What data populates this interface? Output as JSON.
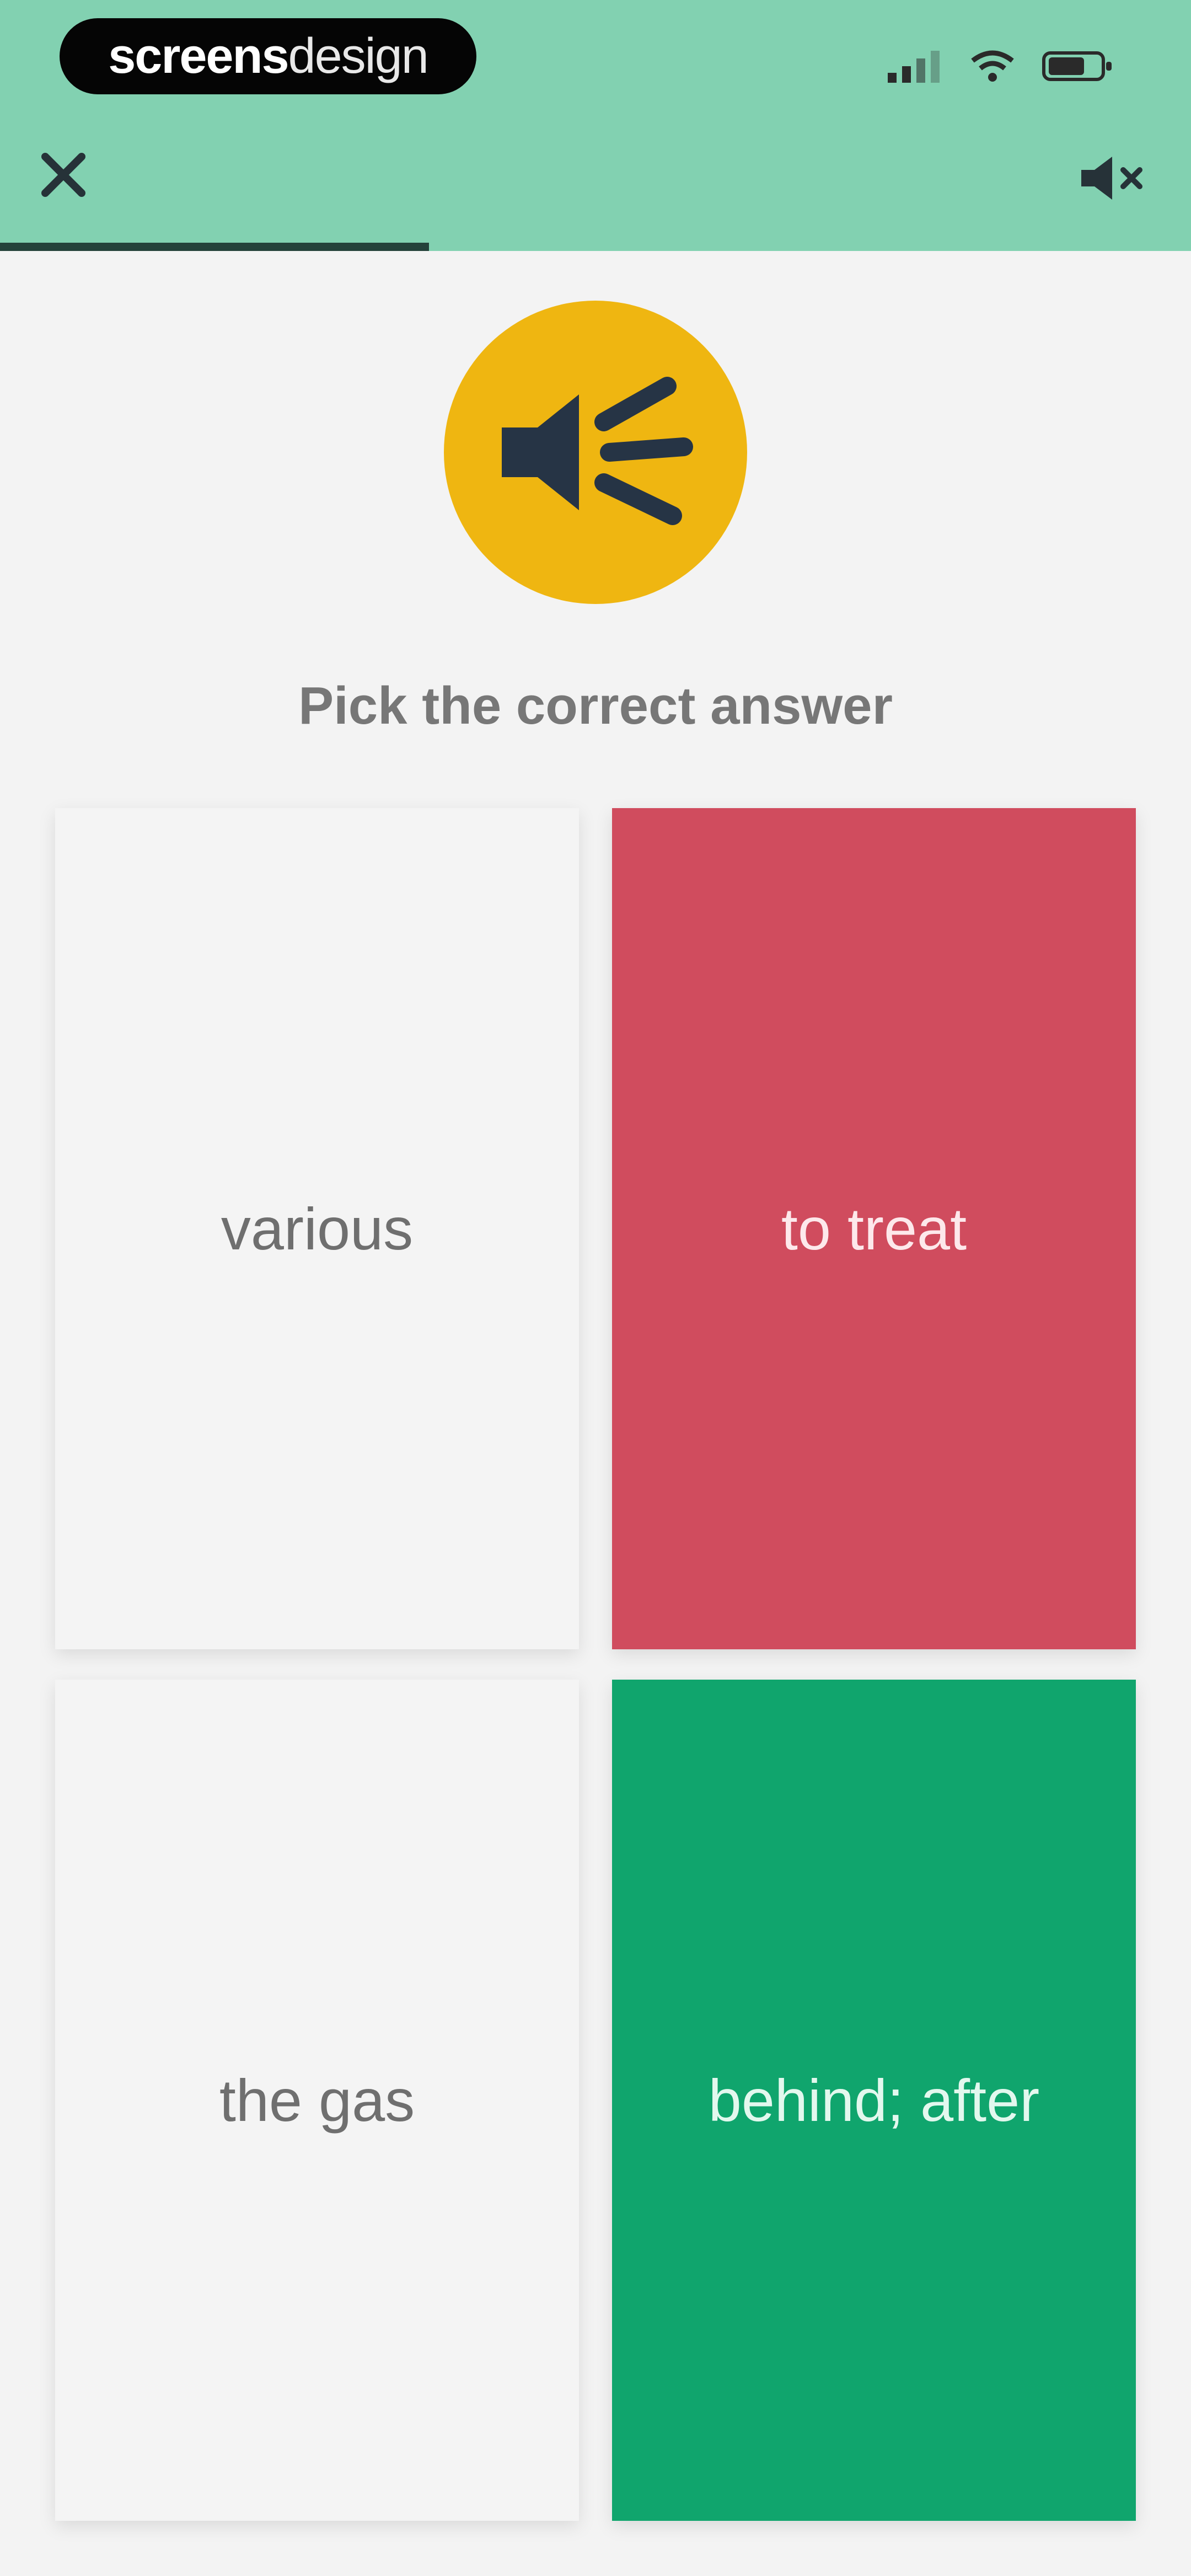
{
  "brand": {
    "part1": "screens",
    "part2": "design"
  },
  "header": {
    "close_icon": "close-icon",
    "sound_icon": "speaker-muted-icon"
  },
  "progress": {
    "fraction": 0.36
  },
  "audio": {
    "icon": "speaker-icon",
    "color": "#efb611"
  },
  "prompt": "Pick the correct answer",
  "answers": [
    {
      "label": "various",
      "state": "neutral"
    },
    {
      "label": "to treat",
      "state": "wrong",
      "color": "#d04c5e"
    },
    {
      "label": "the gas",
      "state": "neutral"
    },
    {
      "label": "behind; after",
      "state": "correct",
      "color": "#10a56d"
    }
  ],
  "colors": {
    "header": "#82d1b1",
    "background": "#f3f3f3"
  }
}
